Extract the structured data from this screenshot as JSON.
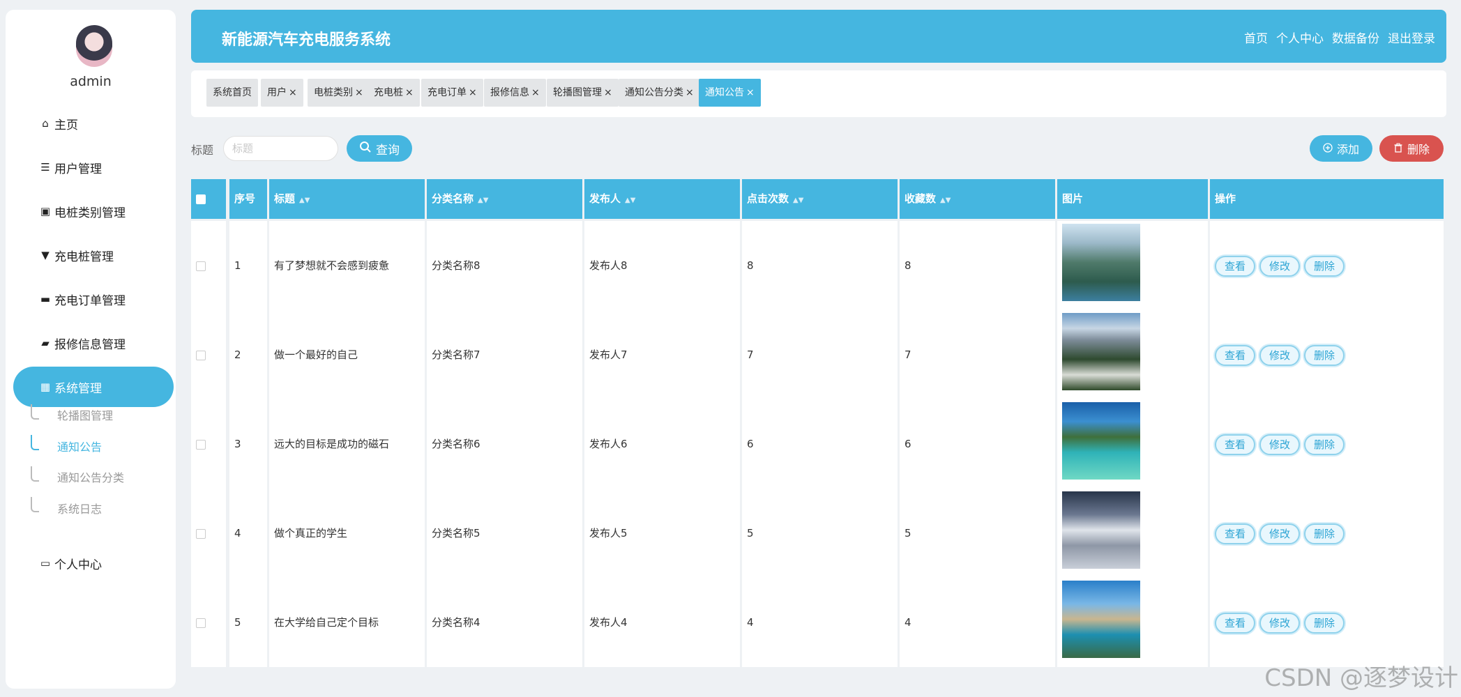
{
  "sidebar": {
    "username": "admin",
    "menu": [
      {
        "label": "主页",
        "icon": "home-icon"
      },
      {
        "label": "用户管理",
        "icon": "list-icon"
      },
      {
        "label": "电桩类别管理",
        "icon": "clipboard-icon"
      },
      {
        "label": "充电桩管理",
        "icon": "plug-icon"
      },
      {
        "label": "充电订单管理",
        "icon": "monitor-icon"
      },
      {
        "label": "报修信息管理",
        "icon": "wallet-icon"
      },
      {
        "label": "系统管理",
        "icon": "grid-icon"
      },
      {
        "label": "个人中心",
        "icon": "card-icon"
      }
    ],
    "submenu": [
      {
        "label": "轮播图管理"
      },
      {
        "label": "通知公告"
      },
      {
        "label": "通知公告分类"
      },
      {
        "label": "系统日志"
      }
    ]
  },
  "header": {
    "title": "新能源汽车充电服务系统",
    "links": [
      "首页",
      "个人中心",
      "数据备份",
      "退出登录"
    ]
  },
  "tabs": [
    {
      "label": "系统首页",
      "closable": false
    },
    {
      "label": "用户",
      "closable": true
    },
    {
      "label": "电桩类别",
      "closable": true
    },
    {
      "label": "充电桩",
      "closable": true
    },
    {
      "label": "充电订单",
      "closable": true
    },
    {
      "label": "报修信息",
      "closable": true
    },
    {
      "label": "轮播图管理",
      "closable": true
    },
    {
      "label": "通知公告分类",
      "closable": true
    },
    {
      "label": "通知公告",
      "closable": true
    }
  ],
  "search": {
    "label": "标题",
    "placeholder": "标题",
    "query_label": "查询",
    "add_label": "添加",
    "delete_label": "删除"
  },
  "table": {
    "headers": [
      "序号",
      "标题",
      "分类名称",
      "发布人",
      "点击次数",
      "收藏数",
      "图片",
      "操作"
    ],
    "actions": [
      "查看",
      "修改",
      "删除"
    ],
    "rows": [
      {
        "no": "1",
        "title": "有了梦想就不会感到疲惫",
        "category": "分类名称8",
        "publisher": "发布人8",
        "clicks": "8",
        "favorites": "8",
        "image": "mountain-river-photo"
      },
      {
        "no": "2",
        "title": "做一个最好的自己",
        "category": "分类名称7",
        "publisher": "发布人7",
        "clicks": "7",
        "favorites": "7",
        "image": "snow-mountain-house-photo"
      },
      {
        "no": "3",
        "title": "远大的目标是成功的磁石",
        "category": "分类名称6",
        "publisher": "发布人6",
        "clicks": "6",
        "favorites": "6",
        "image": "tropical-bungalow-photo"
      },
      {
        "no": "4",
        "title": "做个真正的学生",
        "category": "分类名称5",
        "publisher": "发布人5",
        "clicks": "5",
        "favorites": "5",
        "image": "moon-mountain-photo"
      },
      {
        "no": "5",
        "title": "在大学给自己定个目标",
        "category": "分类名称4",
        "publisher": "发布人4",
        "clicks": "4",
        "favorites": "4",
        "image": "sea-rock-photo"
      }
    ]
  },
  "watermark": "CSDN @逐梦设计",
  "colors": {
    "accent": "#45b6e0",
    "danger": "#d9534f"
  }
}
